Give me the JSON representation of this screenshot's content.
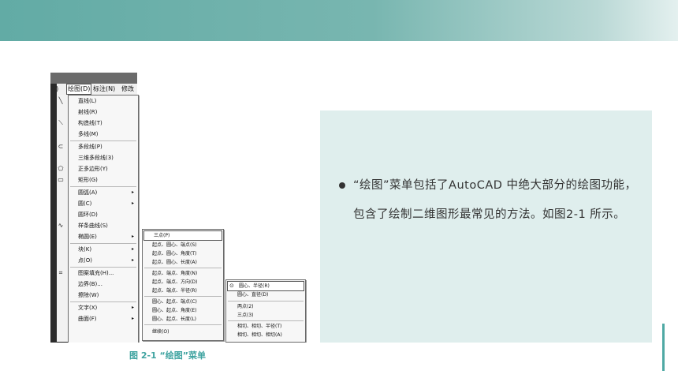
{
  "caption": "图 2-1 “绘图”菜单",
  "paragraph": "“绘图”菜单包括了AutoCAD 中绝大部分的绘图功能，包含了绘制二维图形最常见的方法。如图2-1 所示。",
  "menubar": {
    "left_fragment": "D)",
    "draw": "绘图(D)",
    "dim": "标注(N)",
    "modify": "修改"
  },
  "draw_menu": {
    "items": [
      {
        "label": "直线(L)",
        "icon": "line-icon",
        "arrow": ""
      },
      {
        "label": "射线(R)",
        "icon": "",
        "arrow": ""
      },
      {
        "label": "构造线(T)",
        "icon": "construction-line-icon",
        "arrow": ""
      },
      {
        "label": "多线(M)",
        "icon": "",
        "arrow": ""
      },
      {
        "label": "多段线(P)",
        "icon": "polyline-icon",
        "arrow": ""
      },
      {
        "label": "三维多段线(3)",
        "icon": "",
        "arrow": ""
      },
      {
        "label": "正多边形(Y)",
        "icon": "polygon-icon",
        "arrow": ""
      },
      {
        "label": "矩形(G)",
        "icon": "rectangle-icon",
        "arrow": ""
      },
      {
        "label": "圆弧(A)",
        "icon": "",
        "arrow": "▸"
      },
      {
        "label": "圆(C)",
        "icon": "",
        "arrow": "▸"
      },
      {
        "label": "圆环(D)",
        "icon": "",
        "arrow": ""
      },
      {
        "label": "样条曲线(S)",
        "icon": "spline-icon",
        "arrow": ""
      },
      {
        "label": "椭圆(E)",
        "icon": "",
        "arrow": "▸"
      },
      {
        "label": "块(K)",
        "icon": "",
        "arrow": "▸"
      },
      {
        "label": "点(O)",
        "icon": "",
        "arrow": "▸"
      },
      {
        "label": "图案填充(H)...",
        "icon": "hatch-icon",
        "arrow": ""
      },
      {
        "label": "边界(B)...",
        "icon": "",
        "arrow": ""
      },
      {
        "label": "擦除(W)",
        "icon": "",
        "arrow": ""
      },
      {
        "label": "文字(X)",
        "icon": "",
        "arrow": "▸"
      },
      {
        "label": "曲面(F)",
        "icon": "",
        "arrow": "▸"
      }
    ]
  },
  "arc_submenu": {
    "items": [
      "三点(P)",
      "起点、圆心、端点(S)",
      "起点、圆心、角度(T)",
      "起点、圆心、长度(A)",
      "起点、端点、角度(N)",
      "起点、端点、方向(D)",
      "起点、端点、半径(R)",
      "圆心、起点、端点(C)",
      "圆心、起点、角度(E)",
      "圆心、起点、长度(L)",
      "继续(O)"
    ]
  },
  "circle_submenu": {
    "items": [
      "圆心、半径(R)",
      "圆心、直径(D)",
      "两点(2)",
      "三点(3)",
      "相切、相切、半径(T)",
      "相切、相切、相切(A)"
    ]
  },
  "colors": {
    "accent": "#3ea3a0",
    "banner": "#62aba5",
    "panel": "#dfeeed"
  }
}
